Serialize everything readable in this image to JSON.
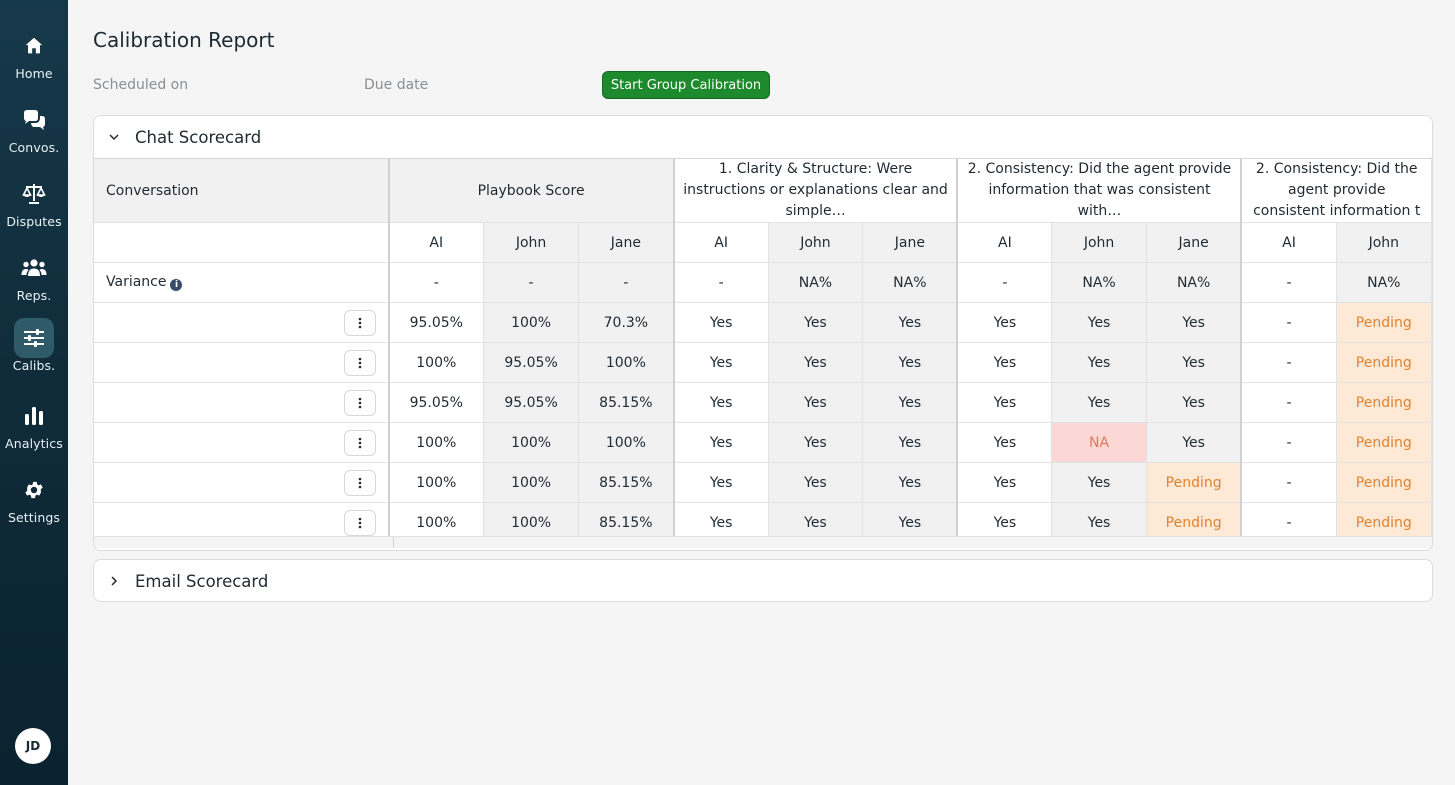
{
  "nav": [
    {
      "key": "home",
      "label": "Home",
      "icon": "home-icon"
    },
    {
      "key": "convos",
      "label": "Convos.",
      "icon": "chat-bubbles-icon"
    },
    {
      "key": "disputes",
      "label": "Disputes",
      "icon": "scales-icon"
    },
    {
      "key": "reps",
      "label": "Reps.",
      "icon": "users-icon"
    },
    {
      "key": "calibs",
      "label": "Calibs.",
      "icon": "sliders-icon"
    },
    {
      "key": "analytics",
      "label": "Analytics",
      "icon": "bar-chart-icon"
    },
    {
      "key": "settings",
      "label": "Settings",
      "icon": "gear-icon"
    }
  ],
  "active_nav": "calibs",
  "user_initials": "JD",
  "page": {
    "title": "Calibration Report",
    "scheduled_label": "Scheduled on",
    "due_label": "Due date",
    "start_button": "Start Group Calibration"
  },
  "colors": {
    "accent_green": "#1e8a2e",
    "sidebar": "#0f2a38",
    "pending_bg": "#fde9d6",
    "na_bg": "#fbd7d5"
  },
  "chat_card": {
    "title": "Chat Scorecard",
    "conversation_header": "Conversation",
    "groups": [
      "Playbook Score",
      "1. Clarity & Structure: Were instructions or explanations clear and simple…",
      "2. Consistency: Did the agent provide information that was consistent with…",
      "2. Consistency: Did the agent provide consistent information t"
    ],
    "sub_headers": [
      "AI",
      "John",
      "Jane",
      "AI",
      "John",
      "Jane",
      "AI",
      "John",
      "Jane",
      "AI",
      "John"
    ],
    "variance_label": "Variance",
    "variance": [
      "-",
      "-",
      "-",
      "-",
      "NA%",
      "NA%",
      "-",
      "NA%",
      "NA%",
      "-",
      "NA%"
    ],
    "rows": [
      [
        "95.05%",
        "100%",
        "70.3%",
        "Yes",
        "Yes",
        "Yes",
        "Yes",
        "Yes",
        "Yes",
        "-",
        "Pending"
      ],
      [
        "100%",
        "95.05%",
        "100%",
        "Yes",
        "Yes",
        "Yes",
        "Yes",
        "Yes",
        "Yes",
        "-",
        "Pending"
      ],
      [
        "95.05%",
        "95.05%",
        "85.15%",
        "Yes",
        "Yes",
        "Yes",
        "Yes",
        "Yes",
        "Yes",
        "-",
        "Pending"
      ],
      [
        "100%",
        "100%",
        "100%",
        "Yes",
        "Yes",
        "Yes",
        "Yes",
        "NA",
        "Yes",
        "-",
        "Pending"
      ],
      [
        "100%",
        "100%",
        "85.15%",
        "Yes",
        "Yes",
        "Yes",
        "Yes",
        "Yes",
        "Pending",
        "-",
        "Pending"
      ],
      [
        "100%",
        "100%",
        "85.15%",
        "Yes",
        "Yes",
        "Yes",
        "Yes",
        "Yes",
        "Pending",
        "-",
        "Pending"
      ]
    ]
  },
  "email_card": {
    "title": "Email Scorecard"
  }
}
